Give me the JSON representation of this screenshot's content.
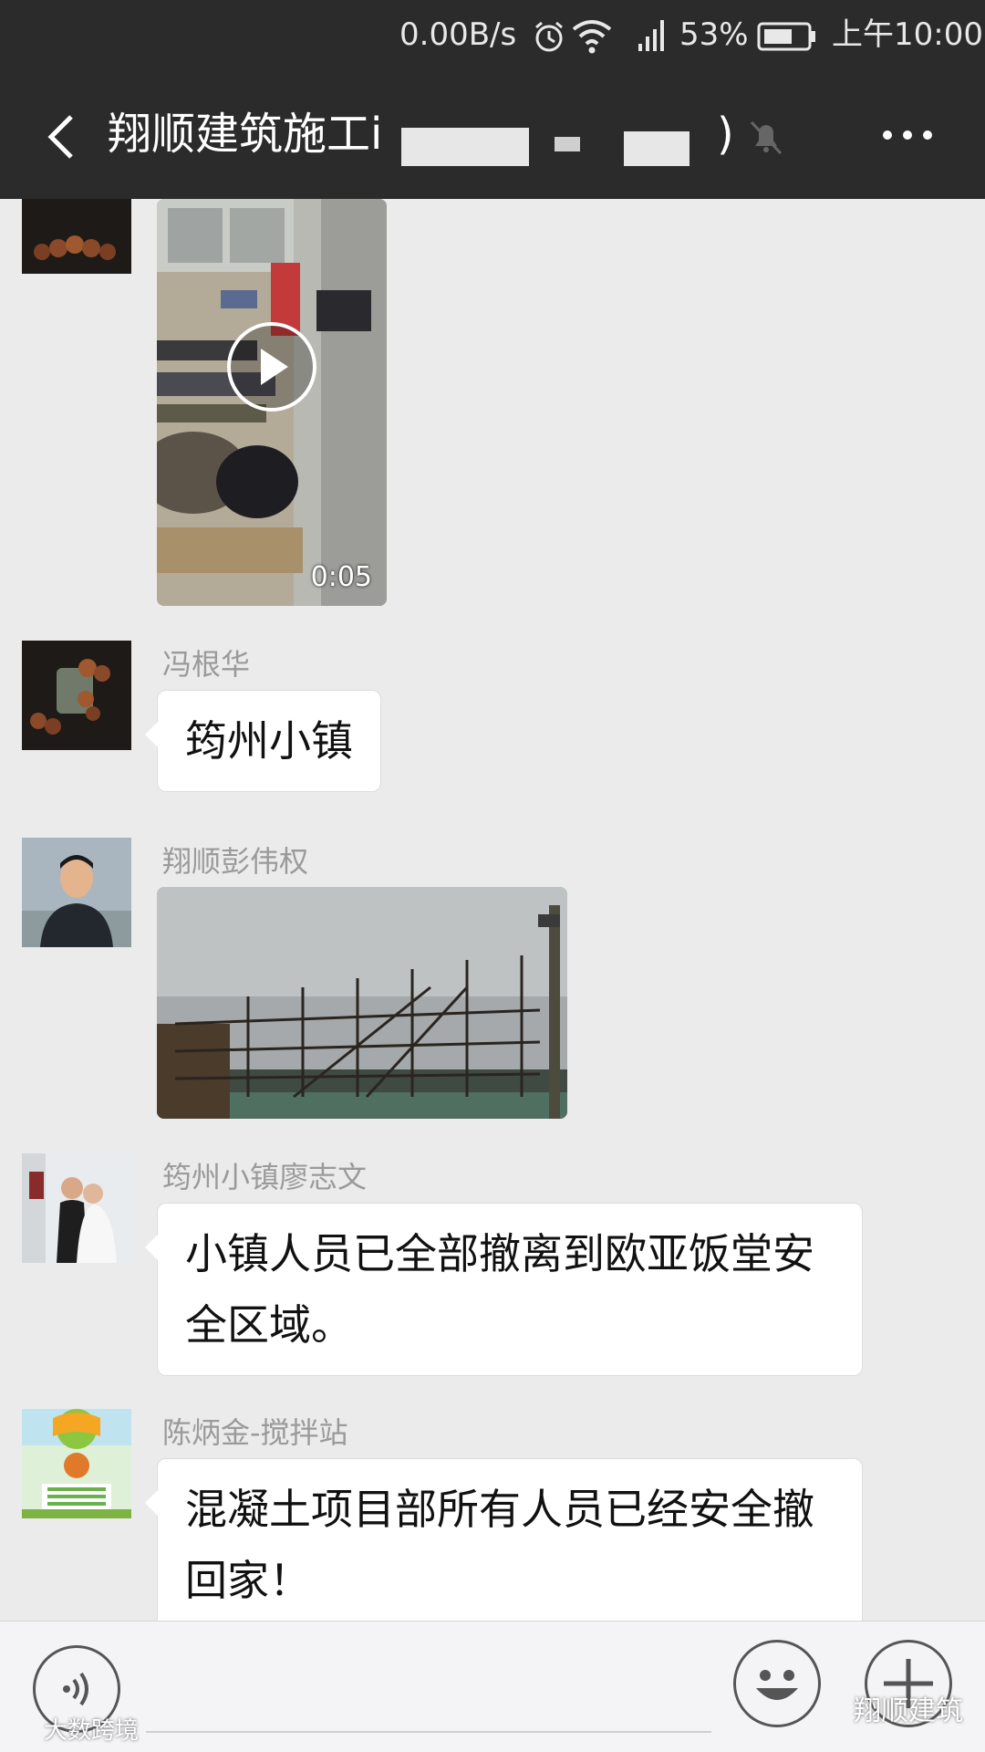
{
  "status": {
    "network_speed": "0.00B/s",
    "battery_percent": "53%",
    "time": "上午10:00",
    "icons": [
      "alarm-icon",
      "wifi-icon",
      "signal-icon",
      "battery-icon"
    ]
  },
  "header": {
    "title": "翔顺建筑施工i",
    "title_tail": ")",
    "icons": [
      "back-icon",
      "mute-bell-icon",
      "more-icon"
    ]
  },
  "messages": [
    {
      "type": "video",
      "duration": "0:05"
    },
    {
      "type": "text",
      "sender": "冯根华",
      "text": "筠州小镇"
    },
    {
      "type": "image",
      "sender": "翔顺彭伟权"
    },
    {
      "type": "text",
      "sender": "筠州小镇廖志文",
      "text": "小镇人员已全部撤离到欧亚饭堂安全区域。"
    },
    {
      "type": "text",
      "sender": "陈炳金-搅拌站",
      "text": "混凝土项目部所有人员已经安全撤回家！"
    }
  ],
  "input_bar": {
    "icons": [
      "voice-icon",
      "emoji-icon",
      "plus-icon"
    ]
  },
  "watermarks": {
    "left": "大数跨境",
    "right": "翔顺建筑"
  },
  "colors": {
    "header_bg": "#2b2b2b",
    "chat_bg": "#ebebeb",
    "bubble_bg": "#ffffff",
    "name_text": "#9a9a9a"
  }
}
